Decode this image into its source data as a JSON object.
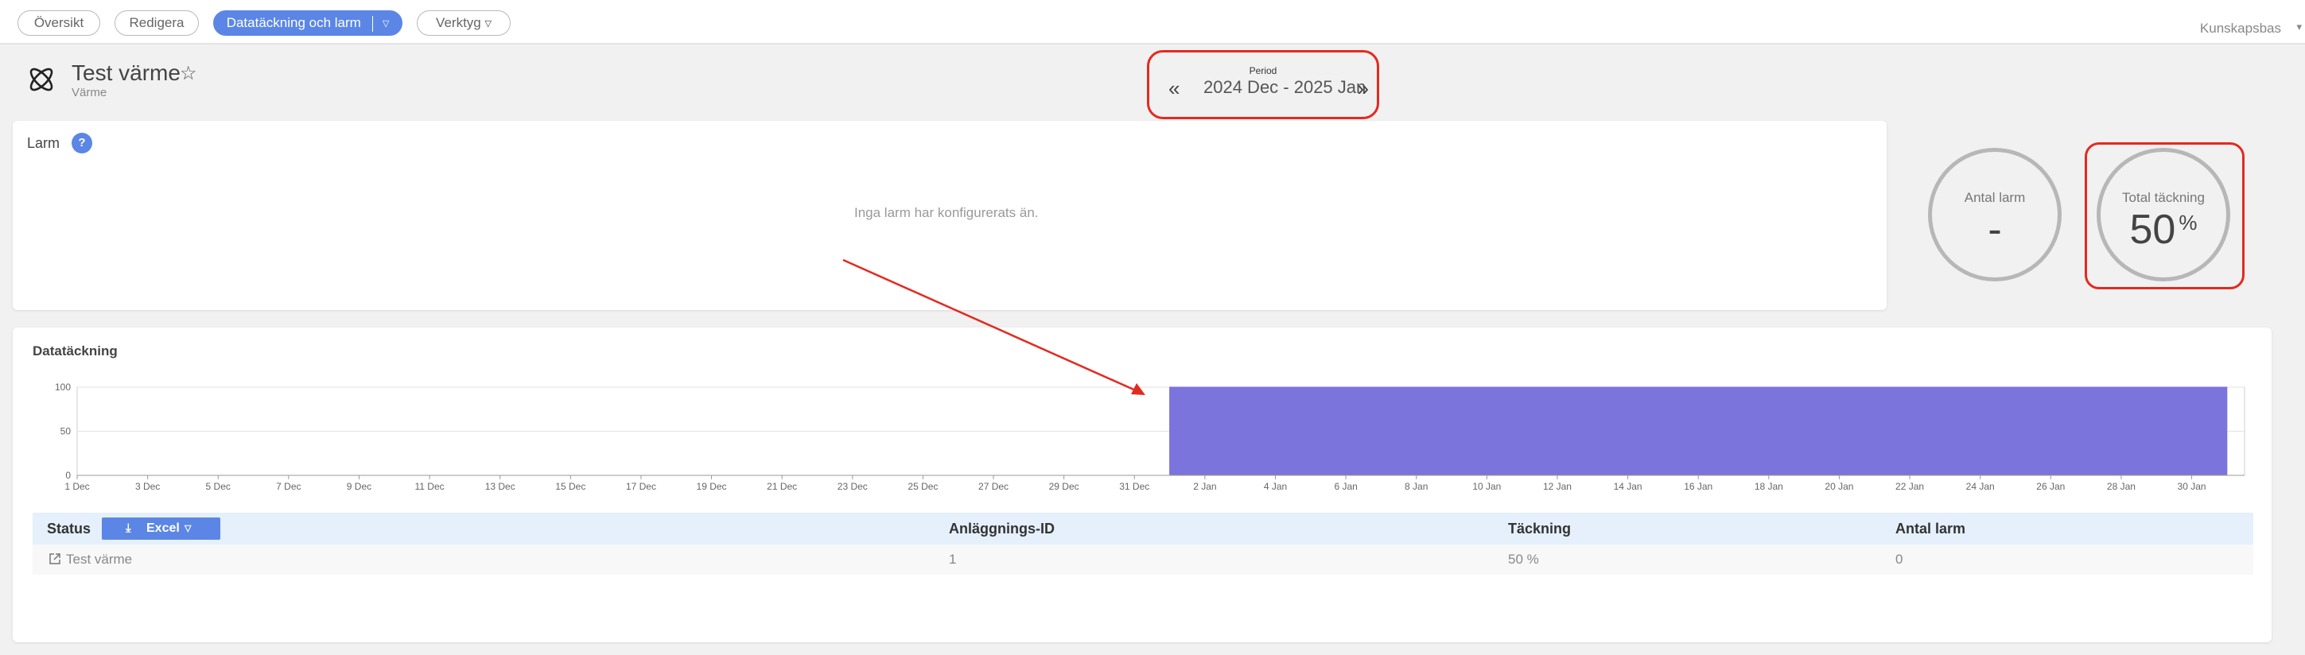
{
  "nav": {
    "tabs": [
      {
        "label": "Översikt",
        "active": false
      },
      {
        "label": "Redigera",
        "active": false
      },
      {
        "label": "Datatäckning och larm",
        "active": true
      },
      {
        "label": "Verktyg",
        "active": false
      }
    ],
    "knowledge_base": "Kunskapsbas"
  },
  "header": {
    "title": "Test värme",
    "subtitle": "Värme",
    "logo_icon": "atom-icon",
    "favorite_icon": "star-outline-icon"
  },
  "period": {
    "label": "Period",
    "value": "2024 Dec - 2025 Jan"
  },
  "larm": {
    "title": "Larm",
    "help": "?",
    "empty_message": "Inga larm har konfigurerats än."
  },
  "stats": {
    "alarm_count_label": "Antal larm",
    "alarm_count_value": "-",
    "total_coverage_label": "Total täckning",
    "total_coverage_value": "50",
    "total_coverage_unit": "%"
  },
  "coverage": {
    "title": "Datatäckning"
  },
  "chart_data": {
    "type": "area",
    "title": "",
    "xlabel": "",
    "ylabel": "",
    "ylim": [
      0,
      100
    ],
    "y_ticks": [
      "0",
      "50",
      "100"
    ],
    "x_ticks": [
      "1 Dec",
      "3 Dec",
      "5 Dec",
      "7 Dec",
      "9 Dec",
      "11 Dec",
      "13 Dec",
      "15 Dec",
      "17 Dec",
      "19 Dec",
      "21 Dec",
      "23 Dec",
      "25 Dec",
      "27 Dec",
      "29 Dec",
      "31 Dec",
      "2 Jan",
      "4 Jan",
      "6 Jan",
      "8 Jan",
      "10 Jan",
      "12 Jan",
      "14 Jan",
      "16 Jan",
      "18 Jan",
      "20 Jan",
      "22 Jan",
      "24 Jan",
      "26 Jan",
      "28 Jan",
      "30 Jan"
    ],
    "series": [
      {
        "points": [
          {
            "x": "2024-12-01",
            "y": 0
          },
          {
            "x": "2025-01-01",
            "y": 0
          },
          {
            "x": "2025-01-01",
            "y": 100
          },
          {
            "x": "2025-01-31",
            "y": 100
          }
        ]
      }
    ],
    "fill_color": "#7b74dd",
    "grid": true,
    "legend": "none"
  },
  "table": {
    "columns": {
      "status": "Status",
      "excel": "Excel",
      "facility_id": "Anläggnings-ID",
      "coverage": "Täckning",
      "alarm_count": "Antal larm"
    },
    "rows": [
      {
        "name": "Test värme",
        "facility_id": "1",
        "coverage": "50 %",
        "alarm_count": "0"
      }
    ]
  },
  "annotation": {
    "color": "#e32a1f"
  }
}
